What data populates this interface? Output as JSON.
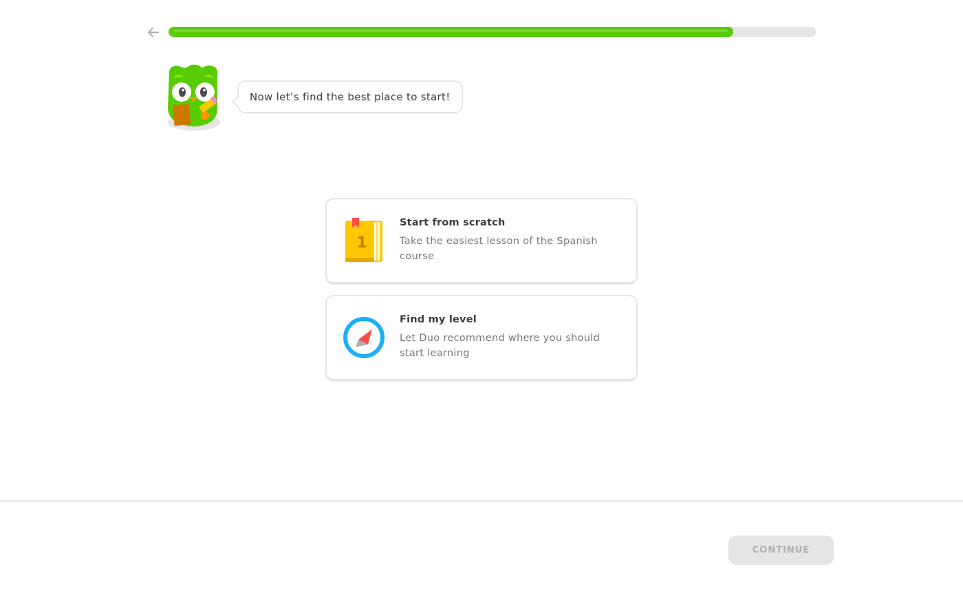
{
  "header": {
    "back_icon": "arrow-left-icon",
    "progress_fraction": 0.872,
    "progress_color": "#58cc02"
  },
  "mascot": {
    "icon": "owl-mascot-icon",
    "speech": "Now let’s find the best place to start!"
  },
  "options": [
    {
      "icon": "book-icon",
      "icon_text": "1",
      "title": "Start from scratch",
      "description": "Take the easiest lesson of the Spanish course"
    },
    {
      "icon": "compass-icon",
      "title": "Find my level",
      "description": "Let Duo recommend where you should start learning"
    }
  ],
  "footer": {
    "continue_label": "CONTINUE"
  }
}
